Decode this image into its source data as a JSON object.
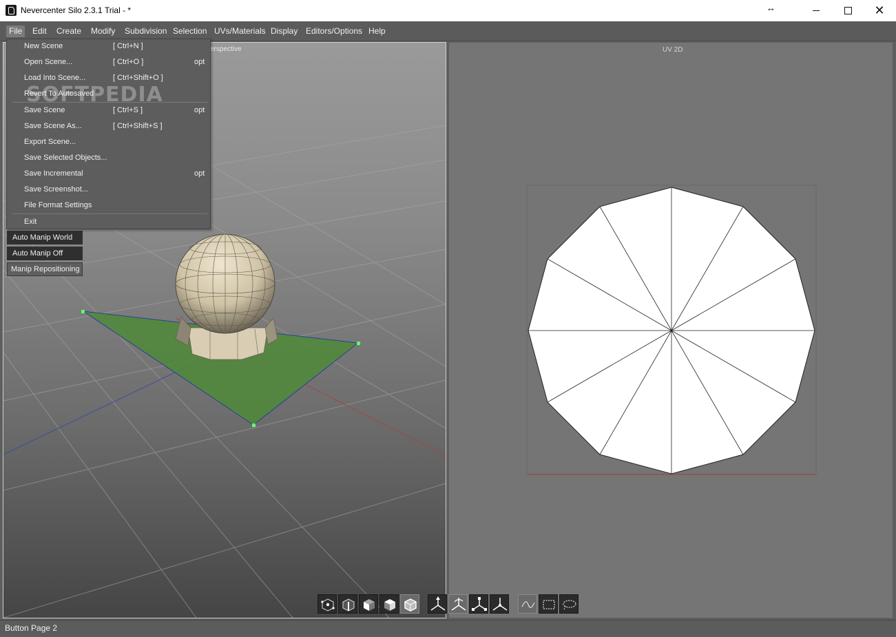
{
  "window": {
    "title": "Nevercenter Silo 2.3.1 Trial - *",
    "resize_glyph": "↔"
  },
  "menubar": {
    "items": [
      "File",
      "Edit",
      "Create",
      "Modify",
      "Subdivision",
      "Selection",
      "UVs/Materials",
      "Display",
      "Editors/Options",
      "Help"
    ]
  },
  "file_menu": {
    "items": [
      {
        "label": "New Scene",
        "shortcut": "[ Ctrl+N ]",
        "opt": ""
      },
      {
        "label": "Open Scene...",
        "shortcut": "[ Ctrl+O ]",
        "opt": "opt"
      },
      {
        "label": "Load Into Scene...",
        "shortcut": "[ Ctrl+Shift+O ]",
        "opt": ""
      },
      {
        "label": "Revert To Autosaved",
        "shortcut": "",
        "opt": ""
      },
      {
        "label": "Save Scene",
        "shortcut": "[ Ctrl+S ]",
        "opt": "opt"
      },
      {
        "label": "Save Scene As...",
        "shortcut": "[ Ctrl+Shift+S ]",
        "opt": ""
      },
      {
        "label": "Export Scene...",
        "shortcut": "",
        "opt": ""
      },
      {
        "label": "Save Selected Objects...",
        "shortcut": "",
        "opt": ""
      },
      {
        "label": "Save Incremental",
        "shortcut": "",
        "opt": "opt"
      },
      {
        "label": "Save Screenshot...",
        "shortcut": "",
        "opt": ""
      },
      {
        "label": "File Format Settings",
        "shortcut": "",
        "opt": ""
      },
      {
        "label": "Exit",
        "shortcut": "",
        "opt": ""
      }
    ]
  },
  "watermark": "SOFTPEDIA",
  "floating_buttons": [
    "Auto Manip World",
    "Auto Manip Off",
    "Manip Repositioning"
  ],
  "viewports": {
    "left_label": "erspective",
    "right_label": "UV 2D"
  },
  "toolbar": {
    "groups": [
      [
        "vertex-mode-icon",
        "edge-mode-icon",
        "face-mode-icon",
        "object-face-mode-icon",
        "object-mode-icon"
      ],
      [
        "move-manip-icon",
        "rotate-manip-icon",
        "scale-manip-icon",
        "universal-manip-icon"
      ],
      [
        "paint-select-icon",
        "box-select-icon",
        "lasso-select-icon"
      ]
    ]
  },
  "colors": {
    "selection_green": "#4f8a3a",
    "uv_fill": "#ffffff",
    "uv_bg": "#757575"
  },
  "status": {
    "text": "Button Page 2"
  }
}
